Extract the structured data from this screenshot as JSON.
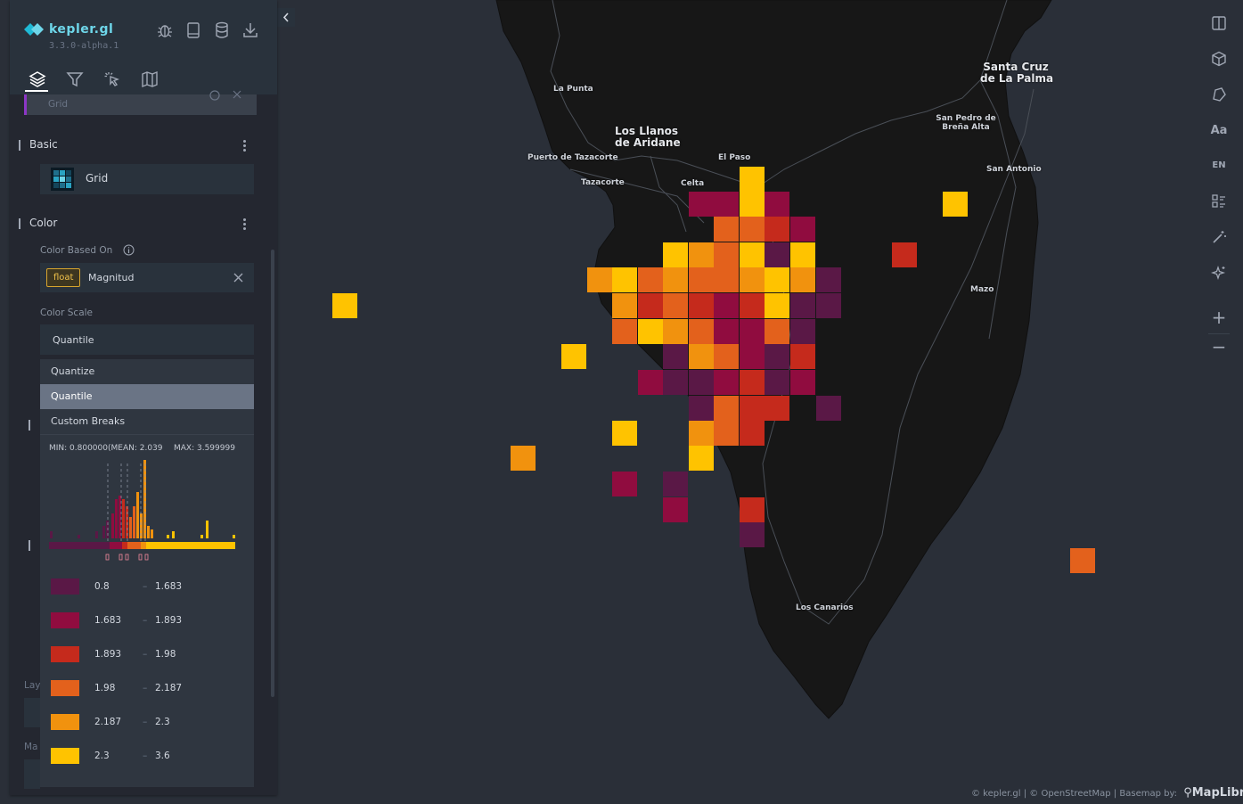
{
  "app": {
    "name": "kepler.gl",
    "version": "3.3.0-alpha.1"
  },
  "panel": {
    "tabs": [
      {
        "name": "layers-tab",
        "icon": "layers-icon",
        "active": true
      },
      {
        "name": "filters-tab",
        "icon": "filter-icon",
        "active": false
      },
      {
        "name": "interactions-tab",
        "icon": "cursor-click-icon",
        "active": false
      },
      {
        "name": "basemap-tab",
        "icon": "map-icon",
        "active": false
      }
    ],
    "header_icons": [
      "bug-icon",
      "docs-icon",
      "database-icon",
      "download-icon"
    ],
    "layer_name_partial": "Grid",
    "basic": {
      "title": "Basic",
      "layer_type": "Grid"
    },
    "color": {
      "title": "Color",
      "based_on_label": "Color Based On",
      "field_type": "float",
      "field_name": "Magnitud",
      "scale_label": "Color Scale",
      "scale_value": "Quantile",
      "options": [
        "Quantize",
        "Quantile",
        "Custom Breaks"
      ],
      "selected_option": "Quantile",
      "stats": {
        "min": "MIN: 0.800000(",
        "mean": "MEAN: 2.039",
        "max": "MAX: 3.599999"
      },
      "legend": [
        {
          "color": "#5a1846",
          "from": "0.8",
          "to": "1.683"
        },
        {
          "color": "#900c3f",
          "from": "1.683",
          "to": "1.893"
        },
        {
          "color": "#c52a1c",
          "from": "1.893",
          "to": "1.98"
        },
        {
          "color": "#e3611c",
          "from": "1.98",
          "to": "2.187"
        },
        {
          "color": "#f1920e",
          "from": "2.187",
          "to": "2.3"
        },
        {
          "color": "#ffc300",
          "from": "2.3",
          "to": "3.6"
        }
      ],
      "legend_dash": "–"
    },
    "hidden_labels": {
      "lay": "Lay",
      "ma": "Ma"
    }
  },
  "map": {
    "places": [
      {
        "name": "La Punta",
        "big": false
      },
      {
        "name": "Los Llanos\nde Aridane",
        "big": true
      },
      {
        "name": "Puerto de Tazacorte",
        "big": false
      },
      {
        "name": "El Paso",
        "big": false
      },
      {
        "name": "Tazacorte",
        "big": false
      },
      {
        "name": "Celta",
        "big": false
      },
      {
        "name": "Santa Cruz\nde La Palma",
        "big": true
      },
      {
        "name": "San Pedro de\nBreña Alta",
        "big": false
      },
      {
        "name": "San Antonio",
        "big": false
      },
      {
        "name": "Mazo",
        "big": false
      },
      {
        "name": "Los Canarios",
        "big": false
      }
    ],
    "attribution": "© kepler.gl | © OpenStreetMap | Basemap by:",
    "maplibre": "MapLibre"
  },
  "right_toolbar": {
    "items": [
      "split-map-icon",
      "3d-view-icon",
      "draw-polygon-icon",
      "Aa",
      "EN",
      "legend-icon",
      "magic-wand-icon",
      "ai-sparkle-icon",
      "+",
      "−"
    ]
  },
  "colors": {
    "panel_bg": "#242730",
    "panel_header": "#29323c",
    "accent": "#6ed6e9",
    "island": "#1a1a1a",
    "sea": "#2a2f38"
  }
}
